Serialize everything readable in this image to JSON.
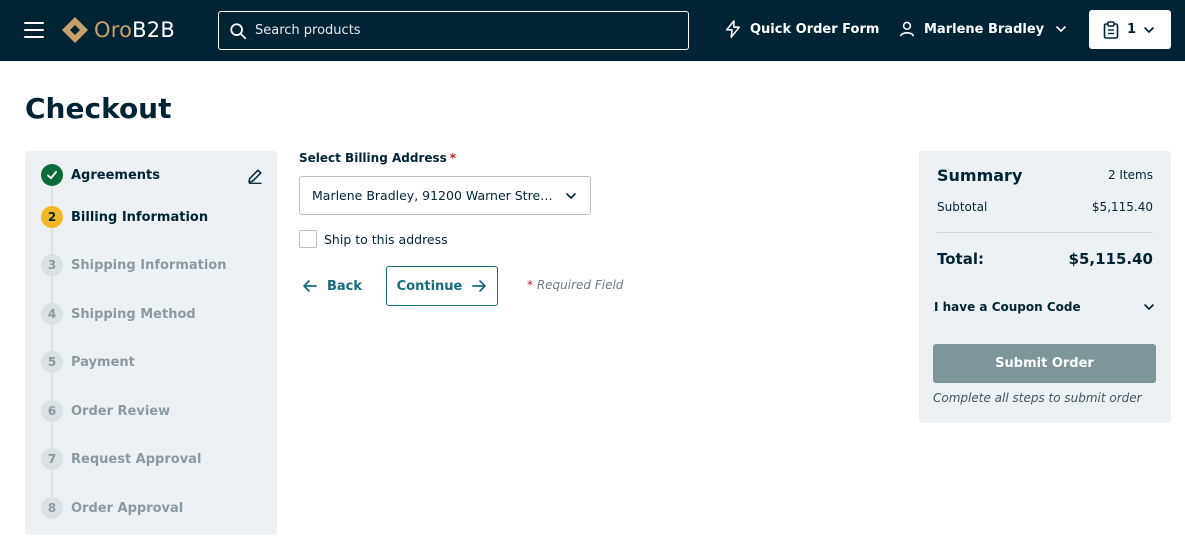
{
  "header": {
    "logo": {
      "part1": "Oro",
      "part2": "B2B"
    },
    "search": {
      "placeholder": "Search products"
    },
    "quick_order_label": "Quick Order Form",
    "user_name": "Marlene Bradley",
    "cart_count": "1",
    "colors": {
      "background": "#002434",
      "logo_accent": "#c8a16a"
    }
  },
  "page": {
    "title": "Checkout"
  },
  "steps": [
    {
      "number": "",
      "label": "Agreements",
      "state": "done"
    },
    {
      "number": "2",
      "label": "Billing Information",
      "state": "current"
    },
    {
      "number": "3",
      "label": "Shipping Information",
      "state": "todo"
    },
    {
      "number": "4",
      "label": "Shipping Method",
      "state": "todo"
    },
    {
      "number": "5",
      "label": "Payment",
      "state": "todo"
    },
    {
      "number": "6",
      "label": "Order Review",
      "state": "todo"
    },
    {
      "number": "7",
      "label": "Request Approval",
      "state": "todo"
    },
    {
      "number": "8",
      "label": "Order Approval",
      "state": "todo"
    }
  ],
  "billing": {
    "label": "Select Billing Address",
    "required_mark": "*",
    "selected_address": "Marlene Bradley, 91200 Warner Street, ...",
    "ship_to_label": "Ship to this address",
    "ship_to_checked": false,
    "back_label": "Back",
    "continue_label": "Continue",
    "required_note_mark": "*",
    "required_note": "Required Field"
  },
  "summary": {
    "title": "Summary",
    "items": "2 Items",
    "subtotal_label": "Subtotal",
    "subtotal_value": "$5,115.40",
    "total_label": "Total:",
    "total_value": "$5,115.40",
    "coupon_label": "I have a Coupon Code",
    "submit_label": "Submit Order",
    "submit_note": "Complete all steps to submit order"
  },
  "icons": [
    "menu-icon",
    "search-icon",
    "lightning-icon",
    "user-icon",
    "chevron-down-icon",
    "clipboard-icon",
    "check-icon",
    "pencil-icon",
    "arrow-left-icon",
    "arrow-right-icon"
  ]
}
